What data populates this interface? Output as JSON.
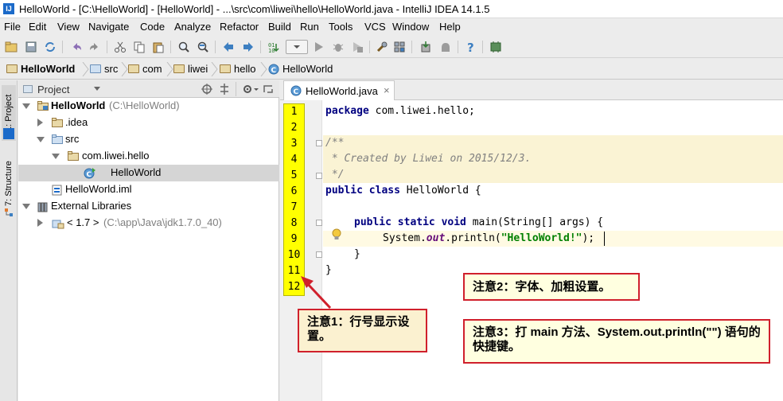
{
  "window": {
    "title": "HelloWorld - [C:\\HelloWorld] - [HelloWorld] - ...\\src\\com\\liwei\\hello\\HelloWorld.java - IntelliJ IDEA 14.1.5",
    "logo_text": "IJ"
  },
  "menu": {
    "items": [
      {
        "label": "File"
      },
      {
        "label": "Edit"
      },
      {
        "label": "View"
      },
      {
        "label": "Navigate"
      },
      {
        "label": "Code"
      },
      {
        "label": "Analyze"
      },
      {
        "label": "Refactor"
      },
      {
        "label": "Build"
      },
      {
        "label": "Run"
      },
      {
        "label": "Tools"
      },
      {
        "label": "VCS"
      },
      {
        "label": "Window"
      },
      {
        "label": "Help"
      }
    ]
  },
  "toolbar": {
    "icons": [
      "open-icon",
      "save-icon",
      "sync-icon",
      "undo-icon",
      "redo-icon",
      "cut-icon",
      "copy-icon",
      "paste-icon",
      "find-icon",
      "replace-icon",
      "back-icon",
      "forward-icon",
      "make-icon",
      "run-config-dropdown",
      "run-icon",
      "debug-icon",
      "coverage-icon",
      "settings-icon",
      "project-structure-icon",
      "sdk-icon",
      "android-icon",
      "help-icon",
      "plugin-icon"
    ]
  },
  "navbar": {
    "crumbs": [
      {
        "label": "HelloWorld",
        "bold": true
      },
      {
        "label": "src"
      },
      {
        "label": "com"
      },
      {
        "label": "liwei"
      },
      {
        "label": "hello"
      },
      {
        "label": "HelloWorld"
      }
    ]
  },
  "sidestrip": {
    "project_tab": "1: Project",
    "structure_tab": "7: Structure"
  },
  "project_panel": {
    "dropdown_label": "Project",
    "tree": [
      {
        "label": "HelloWorld",
        "suffix": "(C:\\HelloWorld)"
      },
      {
        "label": ".idea"
      },
      {
        "label": "src"
      },
      {
        "label": "com.liwei.hello"
      },
      {
        "label": "HelloWorld"
      },
      {
        "label": "HelloWorld.iml"
      },
      {
        "label": "External Libraries"
      },
      {
        "label": "< 1.7 >",
        "suffix": "(C:\\app\\Java\\jdk1.7.0_40)"
      }
    ]
  },
  "editor": {
    "tab_label": "HelloWorld.java",
    "tab_close": "×",
    "line_numbers": [
      "1",
      "2",
      "3",
      "4",
      "5",
      "6",
      "7",
      "8",
      "9",
      "10",
      "11",
      "12"
    ],
    "code": {
      "l1_kw": "package",
      "l1_rest": " com.liwei.hello;",
      "l3": "/**",
      "l4": " * Created by Liwei on 2015/12/3.",
      "l5": " */",
      "l6_kw": "public class",
      "l6_rest": " HelloWorld {",
      "l8_kw": "public static void",
      "l8_rest": " main(String[] args) {",
      "l9_a": "System.",
      "l9_field": "out",
      "l9_b": ".println(",
      "l9_str": "\"HelloWorld!\"",
      "l9_c": ");",
      "l10": "}",
      "l11": "}"
    }
  },
  "callouts": {
    "c1": "注意1：行号显示设置。",
    "c2": "注意2：字体、加粗设置。",
    "c3": "注意3：打 main 方法、System.out.println(\"\") 语句的快捷键。"
  },
  "colors": {
    "line_number_bg": "#FFFF00",
    "callout_border": "#D0202C",
    "comment_highlight": "#FAF3D4",
    "caret_line": "#FFFAE3"
  }
}
